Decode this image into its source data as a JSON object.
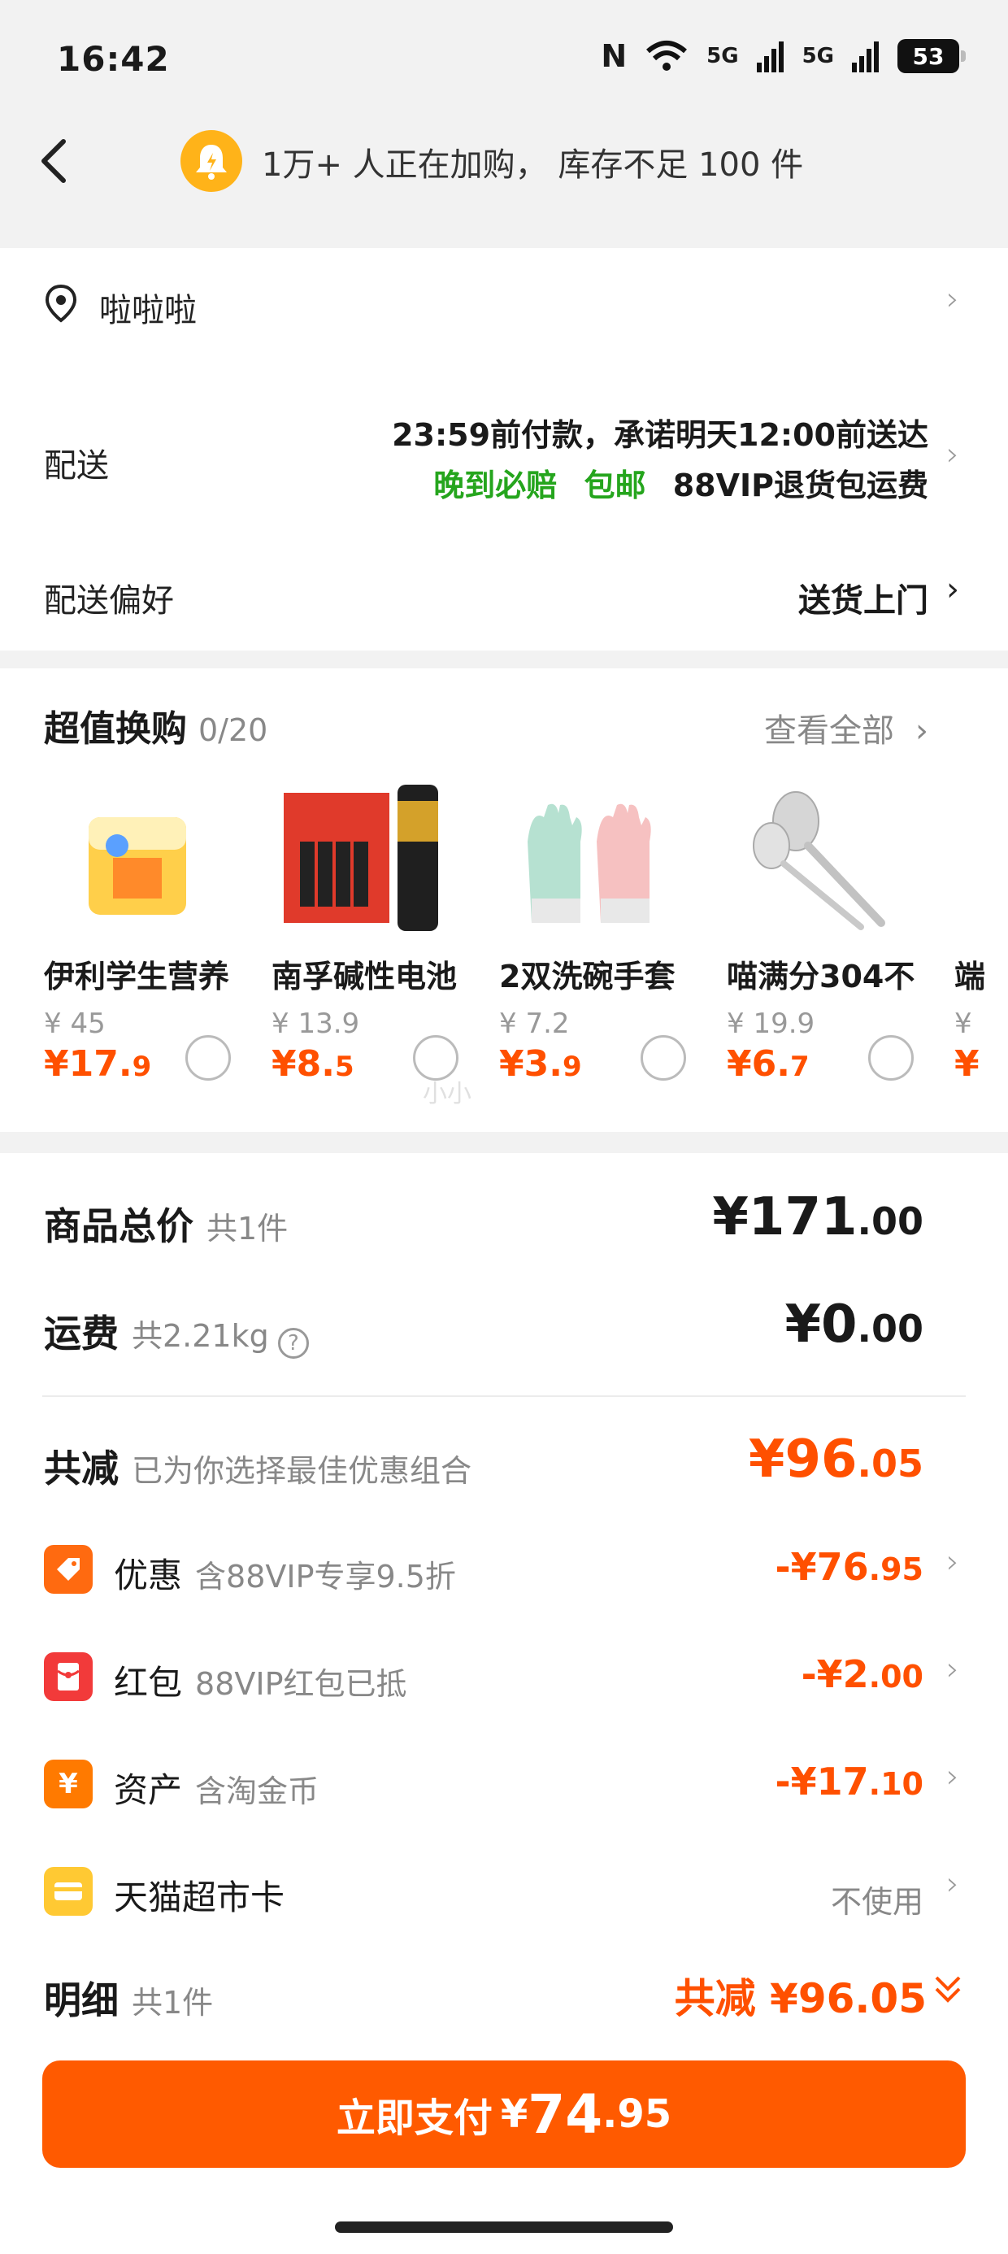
{
  "status_bar": {
    "time": "16:42",
    "nfc": "N",
    "network1": "5G",
    "network2": "5G",
    "battery": "53"
  },
  "header": {
    "back_icon": "chevron-left-icon",
    "bell_icon": "bell-icon",
    "promo_text": "1万+ 人正在加购， 库存不足 100 件"
  },
  "address": {
    "icon": "location-pin-icon",
    "text": "啦啦啦"
  },
  "delivery": {
    "label": "配送",
    "line1": "23:59前付款，承诺明天12:00前送达",
    "tag_late": "晚到必赔",
    "tag_free": "包邮",
    "tag_vip": "88VIP退货包运费"
  },
  "delivery_pref": {
    "label": "配送偏好",
    "value": "送货上门"
  },
  "bundle": {
    "title": "超值换购",
    "count": "0/20",
    "view_all": "查看全部",
    "items": [
      {
        "name": "伊利学生营养",
        "orig": "¥ 45",
        "price_int": "¥17.",
        "price_dec": "9"
      },
      {
        "name": "南孚碱性电池",
        "orig": "¥ 13.9",
        "price_int": "¥8.",
        "price_dec": "5"
      },
      {
        "name": "2双洗碗手套",
        "orig": "¥ 7.2",
        "price_int": "¥3.",
        "price_dec": "9"
      },
      {
        "name": "喵满分304不",
        "orig": "¥ 19.9",
        "price_int": "¥6.",
        "price_dec": "7"
      },
      {
        "name": "端",
        "orig": "¥",
        "price_int": "¥",
        "price_dec": ""
      }
    ]
  },
  "totals": {
    "goods_label": "商品总价",
    "goods_count": "共1件",
    "goods_int": "¥171",
    "goods_dec": ".00",
    "shipping_label": "运费",
    "shipping_weight": "共2.21kg",
    "shipping_int": "¥0",
    "shipping_dec": ".00",
    "discount_label": "共减",
    "discount_sub": "已为你选择最佳优惠组合",
    "discount_int": "¥96",
    "discount_dec": ".05"
  },
  "discounts": [
    {
      "icon": "tag-icon",
      "glyph": "◈",
      "color": "#ff6a10",
      "label": "优惠",
      "sub": "含88VIP专享9.5折",
      "amt_int": "-¥76",
      "amt_dec": ".95"
    },
    {
      "icon": "red-packet-icon",
      "glyph": "▣",
      "color": "#f23a3a",
      "label": "红包",
      "sub": "88VIP红包已抵",
      "amt_int": "-¥2",
      "amt_dec": ".00"
    },
    {
      "icon": "coin-icon",
      "glyph": "¥",
      "color": "#ff7a00",
      "label": "资产",
      "sub": "含淘金币",
      "amt_int": "-¥17",
      "amt_dec": ".10"
    },
    {
      "icon": "card-icon",
      "glyph": "▬",
      "color": "#ffc933",
      "label": "天猫超市卡",
      "sub": "",
      "value": "不使用"
    }
  ],
  "detail": {
    "label": "明细",
    "count": "共1件",
    "summary": "共减 ¥96.05"
  },
  "pay": {
    "label": "立即支付",
    "currency": "¥",
    "int": "74",
    "dec": ".95"
  },
  "watermark": "小小"
}
